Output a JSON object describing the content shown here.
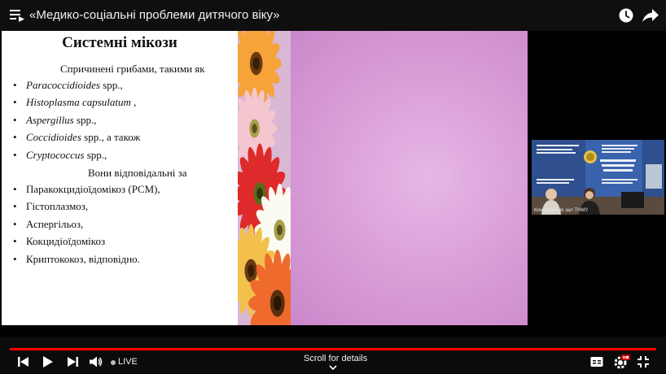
{
  "header": {
    "title": "«Медико-соціальні проблеми дитячого віку»",
    "icons": [
      "playlist-icon",
      "clock-icon",
      "share-icon"
    ]
  },
  "slide": {
    "heading": "Системні мікози",
    "intro": "Спричинені грибами, такими як",
    "pathogens": [
      {
        "name": "Paracoccidioides",
        "suffix": " spp.,"
      },
      {
        "name": "Histoplasma capsulatum",
        "suffix": " ,"
      },
      {
        "name": "Aspergillus",
        "suffix": " spp.,"
      },
      {
        "name": "Coccidioides",
        "suffix": " spp., а також"
      },
      {
        "name": "Cryptococcus",
        "suffix": " spp.,"
      }
    ],
    "lead2": "Вони відповідальні за",
    "diseases": [
      "Паракокцидіоїдомікоз (PCM),",
      "Гістоплазмоз,",
      "Аспергільоз,",
      "Кокцидіоїдомікоз",
      "Криптококоз, відповідно."
    ],
    "bullet": "•"
  },
  "webcam": {
    "caption": "Конференція зал ТНМУ",
    "banner_lines": [
      "Тернопільський національний",
      "медичний університет",
      "імені І.Я.Горбачевського",
      "МОЗ України"
    ]
  },
  "controls": {
    "live_label": "LIVE",
    "scroll_label": "Scroll for details",
    "progress": 1.0,
    "icons": [
      "previous-icon",
      "play-icon",
      "next-icon",
      "volume-icon",
      "captions-icon",
      "settings-icon",
      "exit-fullscreen-icon"
    ]
  },
  "colors": {
    "accent": "#ff0000",
    "slide_pink": "#d79bd6",
    "webcam_blue": "#2b4a84"
  }
}
